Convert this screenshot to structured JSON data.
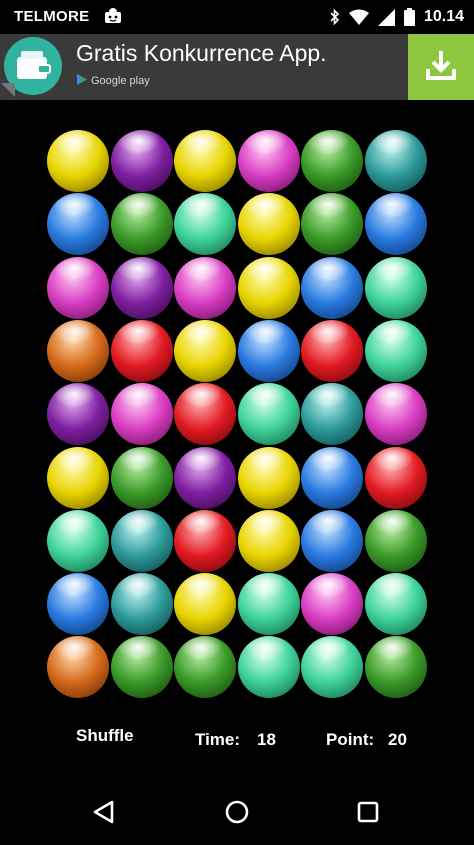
{
  "status_bar": {
    "carrier": "TELMORE",
    "time": "10.14",
    "icons": [
      "carrier-notification-icon",
      "bluetooth-icon",
      "wifi-icon",
      "signal-icon",
      "battery-icon"
    ]
  },
  "ad": {
    "title": "Gratis Konkurrence App.",
    "store": "Google play",
    "icons": [
      "app-logo-icon",
      "google-play-icon",
      "download-icon",
      "ad-info-icon"
    ],
    "colors": {
      "banner": "#3a3a3a",
      "download": "#8dc63f",
      "logo": "#31b39f"
    }
  },
  "board": {
    "rows": 9,
    "cols": 6,
    "grid": [
      [
        "yellow",
        "purple",
        "yellow",
        "magenta",
        "green",
        "teal"
      ],
      [
        "blue",
        "green",
        "mint",
        "yellow",
        "green",
        "blue"
      ],
      [
        "magenta",
        "purple",
        "magenta",
        "yellow",
        "blue",
        "mint"
      ],
      [
        "orange",
        "red",
        "yellow",
        "blue",
        "red",
        "mint"
      ],
      [
        "purple",
        "magenta",
        "red",
        "mint",
        "teal",
        "magenta"
      ],
      [
        "yellow",
        "green",
        "purple",
        "yellow",
        "blue",
        "red"
      ],
      [
        "mint",
        "teal",
        "red",
        "yellow",
        "blue",
        "green"
      ],
      [
        "blue",
        "teal",
        "yellow",
        "mint",
        "magenta",
        "mint"
      ],
      [
        "orange",
        "green",
        "green",
        "mint",
        "mint",
        "green"
      ]
    ],
    "colors": {
      "yellow": {
        "light": "#fffbb0",
        "base": "#e8d400",
        "dark": "#6b5c00"
      },
      "purple": {
        "light": "#e3a8ee",
        "base": "#7e1fa0",
        "dark": "#2c0638"
      },
      "magenta": {
        "light": "#ffc4f2",
        "base": "#d93dc2",
        "dark": "#5a0a4c"
      },
      "green": {
        "light": "#b6eba0",
        "base": "#3a9a28",
        "dark": "#0f3a08"
      },
      "teal": {
        "light": "#b8f0ee",
        "base": "#2d9a9a",
        "dark": "#083838"
      },
      "blue": {
        "light": "#bfe0ff",
        "base": "#2a7ae0",
        "dark": "#08285a"
      },
      "mint": {
        "light": "#d2ffe8",
        "base": "#3ed39a",
        "dark": "#0e5a3c"
      },
      "orange": {
        "light": "#ffd6a8",
        "base": "#d56a1a",
        "dark": "#5a2204"
      },
      "red": {
        "light": "#ffb0b0",
        "base": "#e21a22",
        "dark": "#5a0306"
      }
    }
  },
  "footer": {
    "shuffle_label": "Shuffle",
    "time_label": "Time:",
    "time_value": "18",
    "point_label": "Point:",
    "point_value": "20"
  },
  "nav": {
    "icons": [
      "back-icon",
      "home-icon",
      "recents-icon"
    ]
  }
}
